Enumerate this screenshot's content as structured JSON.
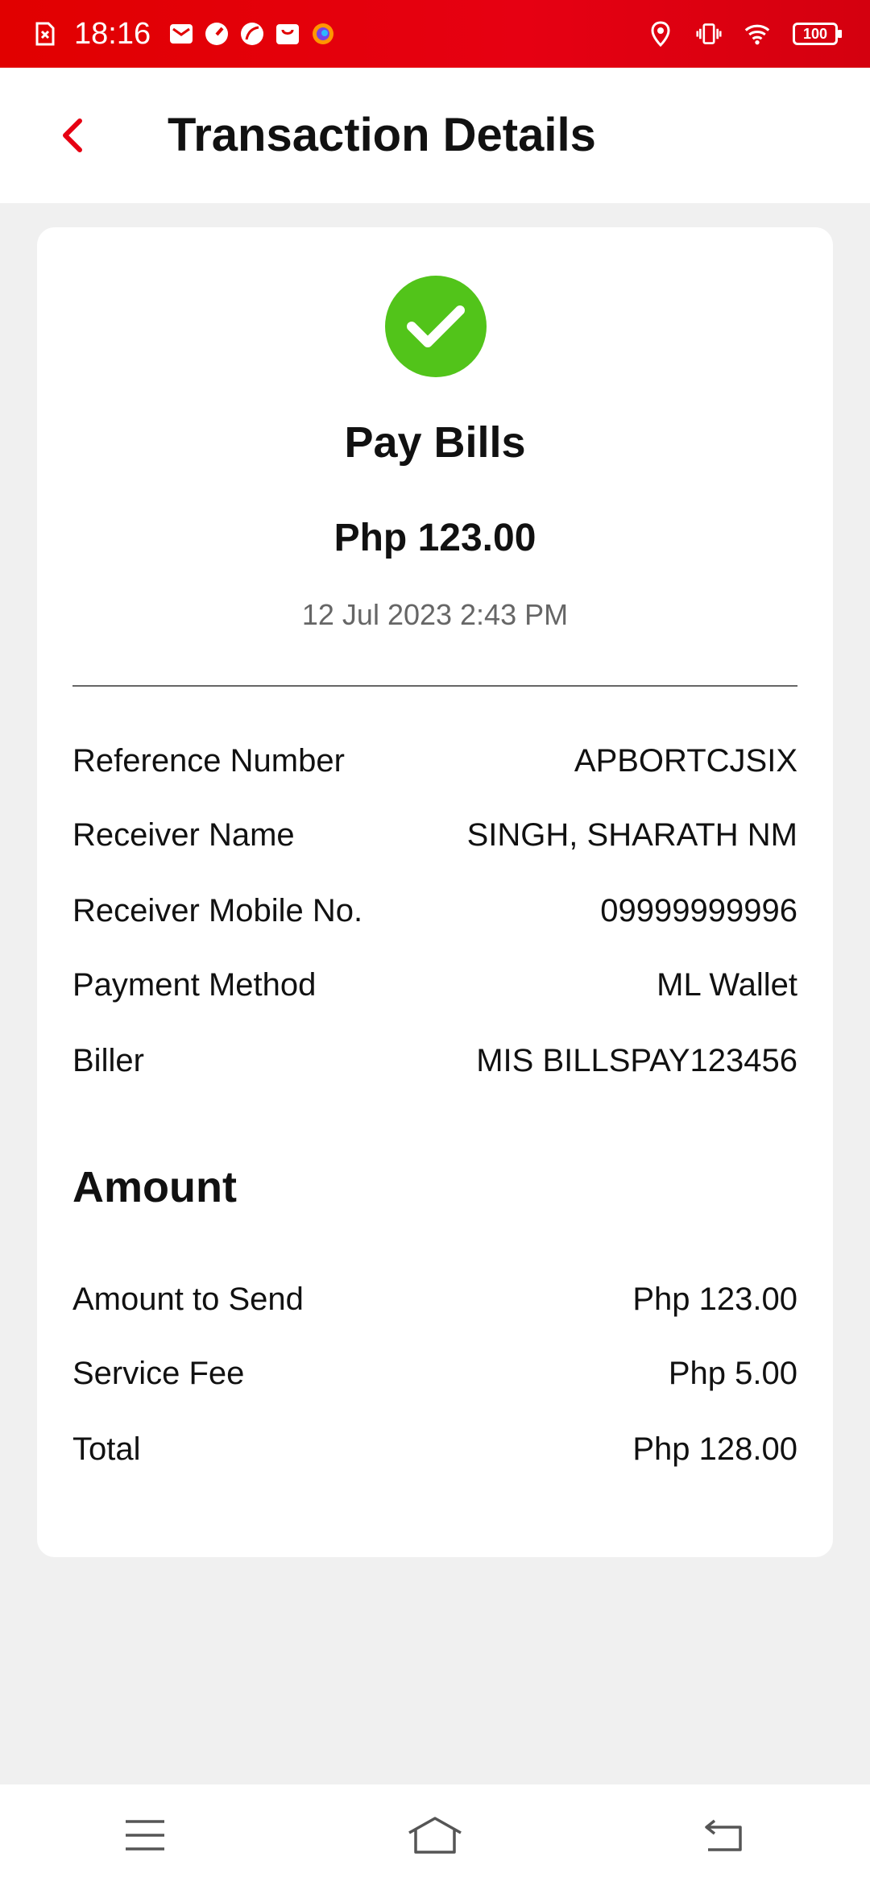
{
  "status_bar": {
    "time": "18:16",
    "battery": "100",
    "icons_left": [
      "sim-error-icon",
      "mail-icon",
      "gauge-icon",
      "leaf-icon",
      "shop-icon",
      "firefox-icon"
    ],
    "icons_right": [
      "location-icon",
      "vibrate-icon",
      "wifi-icon",
      "battery-icon"
    ]
  },
  "header": {
    "title": "Transaction Details",
    "back_icon": "chevron-left-icon",
    "accent_color": "#e60012"
  },
  "transaction": {
    "status_icon": "check-circle-icon",
    "status_color": "#52c41a",
    "title": "Pay Bills",
    "amount": "Php 123.00",
    "datetime": "12 Jul 2023 2:43 PM"
  },
  "details": [
    {
      "label": "Reference Number",
      "value": "APBORTCJSIX"
    },
    {
      "label": "Receiver Name",
      "value": "SINGH, SHARATH NM"
    },
    {
      "label": "Receiver Mobile No.",
      "value": "09999999996"
    },
    {
      "label": "Payment Method",
      "value": "ML Wallet"
    },
    {
      "label": "Biller",
      "value": "MIS BILLSPAY123456"
    }
  ],
  "amount_section": {
    "title": "Amount",
    "rows": [
      {
        "label": "Amount to Send",
        "value": "Php 123.00"
      },
      {
        "label": "Service Fee",
        "value": "Php 5.00"
      },
      {
        "label": "Total",
        "value": "Php 128.00"
      }
    ]
  },
  "nav": {
    "icons": [
      "menu-icon",
      "home-icon",
      "back-icon"
    ]
  }
}
